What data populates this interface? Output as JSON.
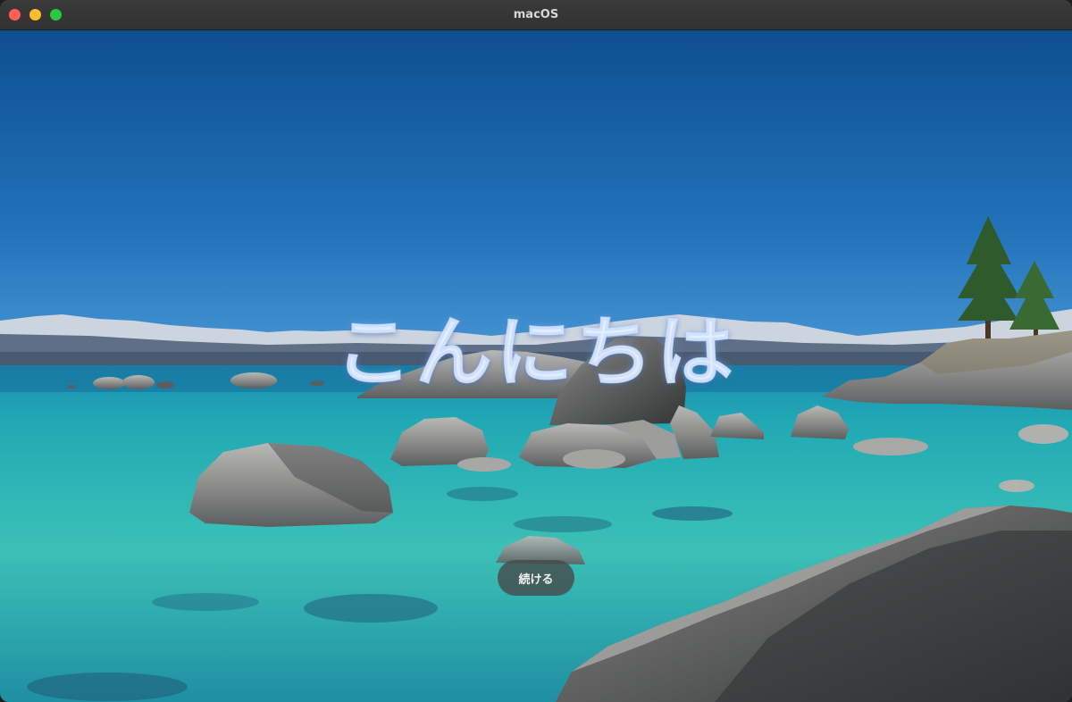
{
  "window": {
    "title": "macOS"
  },
  "welcome": {
    "greeting": "こんにちは",
    "continue_label": "続ける"
  },
  "colors": {
    "close": "#fe5f57",
    "minimize": "#febc2e",
    "zoom": "#28c840",
    "sky_top": "#0f5391",
    "sky_bottom": "#3d8fd0",
    "water": "#2bb3b3"
  }
}
